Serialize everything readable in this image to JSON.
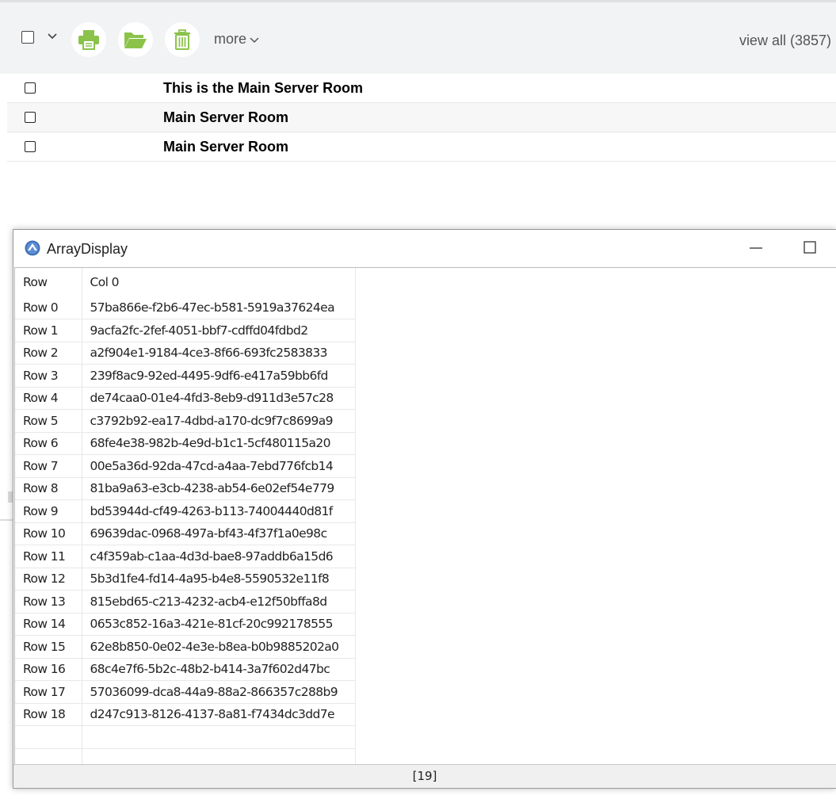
{
  "toolbar": {
    "more_label": "more",
    "view_all_label": "view all (3857)",
    "accent_color": "#8bc34a",
    "icons": [
      "checkbox-icon",
      "chevron-down-icon",
      "printer-icon",
      "folder-open-icon",
      "trash-icon",
      "chevron-down-icon"
    ]
  },
  "mail_list": [
    {
      "subject": "This is the Main Server Room"
    },
    {
      "subject": "Main Server Room"
    },
    {
      "subject": "Main Server Room"
    }
  ],
  "window": {
    "title": "ArrayDisplay",
    "status": "[19]"
  },
  "grid": {
    "headers": [
      "Row",
      "Col 0"
    ],
    "rows": [
      [
        "Row 0",
        "57ba866e-f2b6-47ec-b581-5919a37624ea"
      ],
      [
        "Row 1",
        "9acfa2fc-2fef-4051-bbf7-cdffd04fdbd2"
      ],
      [
        "Row 2",
        "a2f904e1-9184-4ce3-8f66-693fc2583833"
      ],
      [
        "Row 3",
        "239f8ac9-92ed-4495-9df6-e417a59bb6fd"
      ],
      [
        "Row 4",
        "de74caa0-01e4-4fd3-8eb9-d911d3e57c28"
      ],
      [
        "Row 5",
        "c3792b92-ea17-4dbd-a170-dc9f7c8699a9"
      ],
      [
        "Row 6",
        "68fe4e38-982b-4e9d-b1c1-5cf480115a20"
      ],
      [
        "Row 7",
        "00e5a36d-92da-47cd-a4aa-7ebd776fcb14"
      ],
      [
        "Row 8",
        "81ba9a63-e3cb-4238-ab54-6e02ef54e779"
      ],
      [
        "Row 9",
        "bd53944d-cf49-4263-b113-74004440d81f"
      ],
      [
        "Row 10",
        "69639dac-0968-497a-bf43-4f37f1a0e98c"
      ],
      [
        "Row 11",
        "c4f359ab-c1aa-4d3d-bae8-97addb6a15d6"
      ],
      [
        "Row 12",
        "5b3d1fe4-fd14-4a95-b4e8-5590532e11f8"
      ],
      [
        "Row 13",
        "815ebd65-c213-4232-acb4-e12f50bffa8d"
      ],
      [
        "Row 14",
        "0653c852-16a3-421e-81cf-20c992178555"
      ],
      [
        "Row 15",
        "62e8b850-0e02-4e3e-b8ea-b0b9885202a0"
      ],
      [
        "Row 16",
        "68c4e7f6-5b2c-48b2-b414-3a7f602d47bc"
      ],
      [
        "Row 17",
        "57036099-dca8-44a9-88a2-866357c288b9"
      ],
      [
        "Row 18",
        "d247c913-8126-4137-8a81-f7434dc3dd7e"
      ],
      [
        "",
        ""
      ],
      [
        "",
        ""
      ]
    ]
  }
}
